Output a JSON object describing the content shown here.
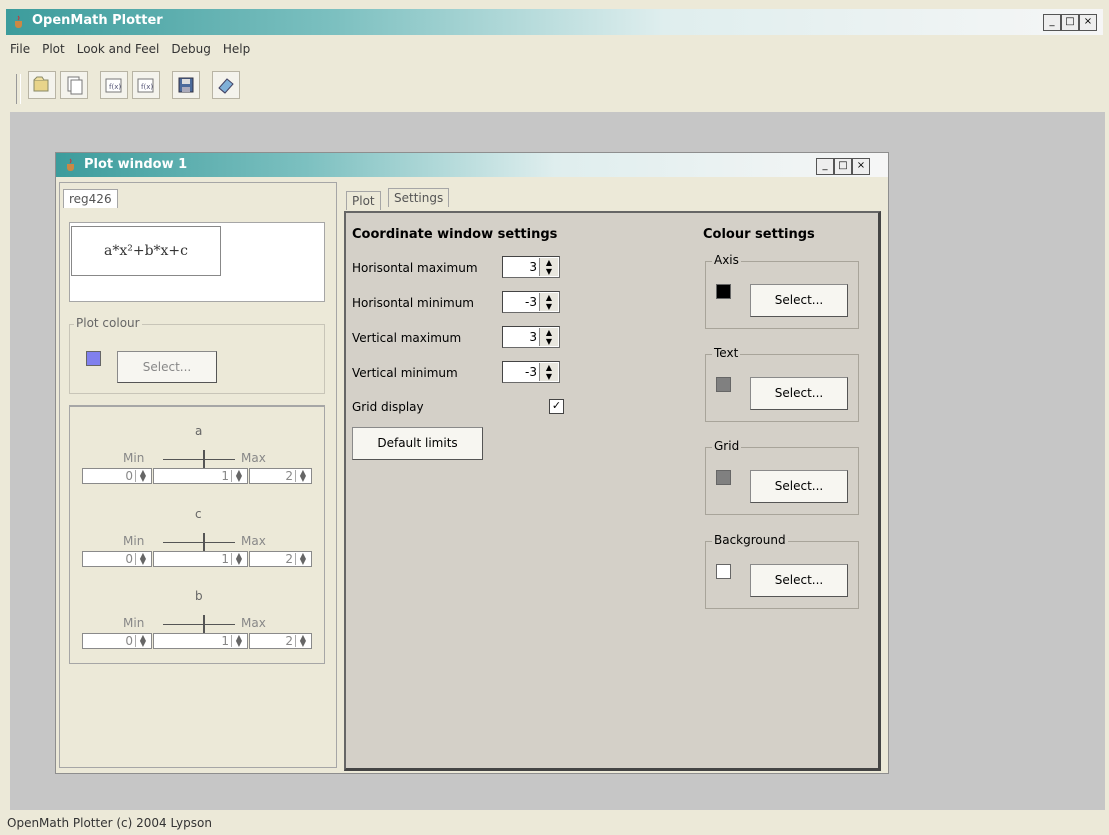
{
  "app": {
    "title": "OpenMath Plotter",
    "status": "OpenMath Plotter (c) 2004 Lypson"
  },
  "window_buttons": {
    "minimize": "_",
    "maximize": "□",
    "close": "×"
  },
  "menu": [
    "File",
    "Plot",
    "Look and Feel",
    "Debug",
    "Help"
  ],
  "toolbar_icons": [
    "open-icon",
    "new-document-icon",
    "formula-add-icon",
    "formula-edit-icon",
    "save-icon",
    "eraser-icon"
  ],
  "plot_window": {
    "title": "Plot window 1",
    "left": {
      "tab": "reg426",
      "formula": "a*x²+b*x+c",
      "plot_colour": {
        "label": "Plot colour",
        "swatch": "#8080ee",
        "button": "Select..."
      },
      "params": [
        {
          "name": "a",
          "min_label": "Min",
          "max_label": "Max",
          "min": "0",
          "value": "1",
          "max": "2"
        },
        {
          "name": "c",
          "min_label": "Min",
          "max_label": "Max",
          "min": "0",
          "value": "1",
          "max": "2"
        },
        {
          "name": "b",
          "min_label": "Min",
          "max_label": "Max",
          "min": "0",
          "value": "1",
          "max": "2"
        }
      ]
    },
    "right": {
      "tabs": [
        "Plot",
        "Settings"
      ],
      "coord_title": "Coordinate window settings",
      "fields": [
        {
          "label": "Horisontal maximum",
          "value": "3"
        },
        {
          "label": "Horisontal minimum",
          "value": "-3"
        },
        {
          "label": "Vertical maximum",
          "value": "3"
        },
        {
          "label": "Vertical minimum",
          "value": "-3"
        }
      ],
      "grid_display": {
        "label": "Grid display",
        "checked": "✓"
      },
      "default_limits": "Default limits",
      "colour_title": "Colour settings",
      "colour_groups": [
        {
          "label": "Axis",
          "swatch": "#000000",
          "button": "Select..."
        },
        {
          "label": "Text",
          "swatch": "#808080",
          "button": "Select..."
        },
        {
          "label": "Grid",
          "swatch": "#808080",
          "button": "Select..."
        },
        {
          "label": "Background",
          "swatch": "#ffffff",
          "button": "Select..."
        }
      ]
    }
  }
}
